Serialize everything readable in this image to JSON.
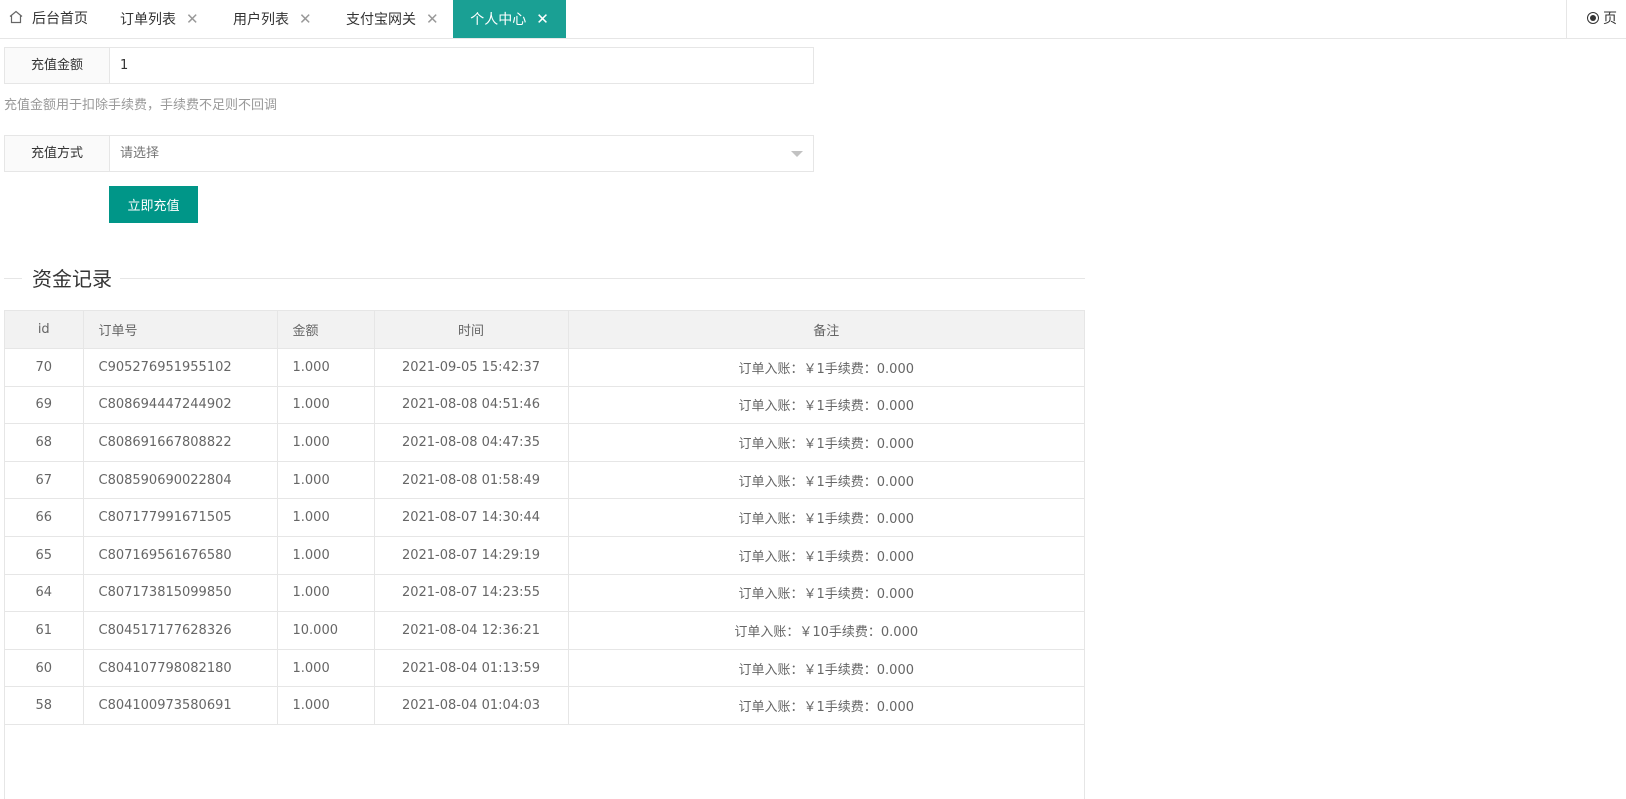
{
  "tabs": [
    {
      "label": "后台首页",
      "closable": false,
      "active": false,
      "icon": "home-icon"
    },
    {
      "label": "订单列表",
      "closable": true,
      "active": false
    },
    {
      "label": "用户列表",
      "closable": true,
      "active": false
    },
    {
      "label": "支付宝网关",
      "closable": true,
      "active": false
    },
    {
      "label": "个人中心",
      "closable": true,
      "active": true
    }
  ],
  "tab_close_glyph": "✕",
  "tab_right": {
    "label": "页",
    "icon": "radio-icon"
  },
  "form": {
    "amount_label": "充值金额",
    "amount_value": "1",
    "amount_hint": "充值金额用于扣除手续费，手续费不足则不回调",
    "method_label": "充值方式",
    "method_placeholder": "请选择",
    "submit_label": "立即充值"
  },
  "records": {
    "title": "资金记录",
    "columns": [
      "id",
      "订单号",
      "金额",
      "时间",
      "备注"
    ],
    "rows": [
      [
        "70",
        "C905276951955102",
        "1.000",
        "2021-09-05 15:42:37",
        "订单入账：￥1手续费：0.000"
      ],
      [
        "69",
        "C808694447244902",
        "1.000",
        "2021-08-08 04:51:46",
        "订单入账：￥1手续费：0.000"
      ],
      [
        "68",
        "C808691667808822",
        "1.000",
        "2021-08-08 04:47:35",
        "订单入账：￥1手续费：0.000"
      ],
      [
        "67",
        "C808590690022804",
        "1.000",
        "2021-08-08 01:58:49",
        "订单入账：￥1手续费：0.000"
      ],
      [
        "66",
        "C807177991671505",
        "1.000",
        "2021-08-07 14:30:44",
        "订单入账：￥1手续费：0.000"
      ],
      [
        "65",
        "C807169561676580",
        "1.000",
        "2021-08-07 14:29:19",
        "订单入账：￥1手续费：0.000"
      ],
      [
        "64",
        "C807173815099850",
        "1.000",
        "2021-08-07 14:23:55",
        "订单入账：￥1手续费：0.000"
      ],
      [
        "61",
        "C804517177628326",
        "10.000",
        "2021-08-04 12:36:21",
        "订单入账：￥10手续费：0.000"
      ],
      [
        "60",
        "C804107798082180",
        "1.000",
        "2021-08-04 01:13:59",
        "订单入账：￥1手续费：0.000"
      ],
      [
        "58",
        "C804100973580691",
        "1.000",
        "2021-08-04 01:04:03",
        "订单入账：￥1手续费：0.000"
      ]
    ]
  },
  "colors": {
    "accent": "#009688",
    "active_tab": "#1aa094"
  }
}
